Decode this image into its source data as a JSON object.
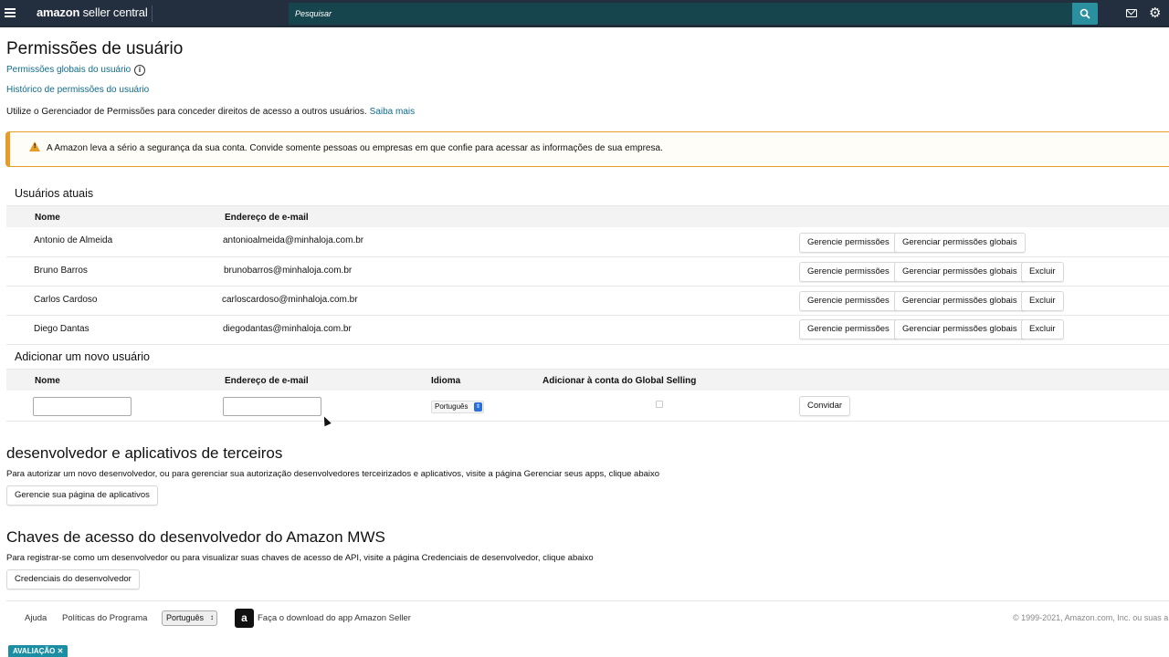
{
  "header": {
    "logo_main": "amazon",
    "logo_sub": "seller central",
    "search_placeholder": "Pesquisar"
  },
  "page": {
    "title": "Permissões de usuário",
    "global_permissions_link": "Permissões globais do usuário",
    "history_link": "Histórico de permissões do usuário",
    "intro_text": "Utilize o Gerenciador de Permissões para conceder direitos de acesso a outros usuários.",
    "learn_more": "Saiba mais"
  },
  "alert": {
    "text": "A Amazon leva a sério a segurança da sua conta. Convide somente pessoas ou empresas em que confie para acessar as informações de sua empresa.",
    "color": "#e59d27"
  },
  "current_users": {
    "title": "Usuários atuais",
    "columns": [
      "Nome",
      "Endereço de e-mail"
    ],
    "manage_label": "Gerencie permissões",
    "manage_global_label": "Gerenciar permissões globais",
    "delete_label": "Excluir",
    "rows": [
      {
        "name": "Antonio de Almeida",
        "email": "antonioalmeida@minhaloja.com.br"
      },
      {
        "name": "Bruno Barros",
        "email": "brunobarros@minhaloja.com.br"
      },
      {
        "name": "Carlos Cardoso",
        "email": "carloscardoso@minhaloja.com.br"
      },
      {
        "name": "Diego Dantas",
        "email": "diegodantas@minhaloja.com.br"
      }
    ]
  },
  "add_user": {
    "title": "Adicionar um novo usuário",
    "columns": [
      "Nome",
      "Endereço de e-mail",
      "Idioma",
      "Adicionar à conta do Global Selling"
    ],
    "name_value": "",
    "email_value": "",
    "language_value": "Português",
    "invite_label": "Convidar"
  },
  "developer": {
    "title": "desenvolvedor e aplicativos de terceiros",
    "description": "Para autorizar um novo desenvolvedor, ou para gerenciar sua autorização desenvolvedores terceirizados e aplicativos, visite a página Gerenciar seus apps, clique abaixo",
    "button": "Gerencie sua página de aplicativos"
  },
  "mws": {
    "title": "Chaves de acesso do desenvolvedor do Amazon MWS",
    "description": "Para registrar-se como um desenvolvedor ou para visualizar suas chaves de acesso de API, visite a página Credenciais de desenvolvedor, clique abaixo",
    "button": "Credenciais do desenvolvedor"
  },
  "footer": {
    "help": "Ajuda",
    "policies": "Políticas do Programa",
    "language": "Português",
    "app_icon_letter": "a",
    "download_app": "Faça o download do app Amazon Seller",
    "copyright": "© 1999-2021, Amazon.com, Inc. ou suas a",
    "badge": "AVALIAÇÃO ✕"
  },
  "colors": {
    "topbar": "#232f3e",
    "search": "#17454e",
    "search_button": "#2a8f9e",
    "link": "#0e6b8a"
  }
}
